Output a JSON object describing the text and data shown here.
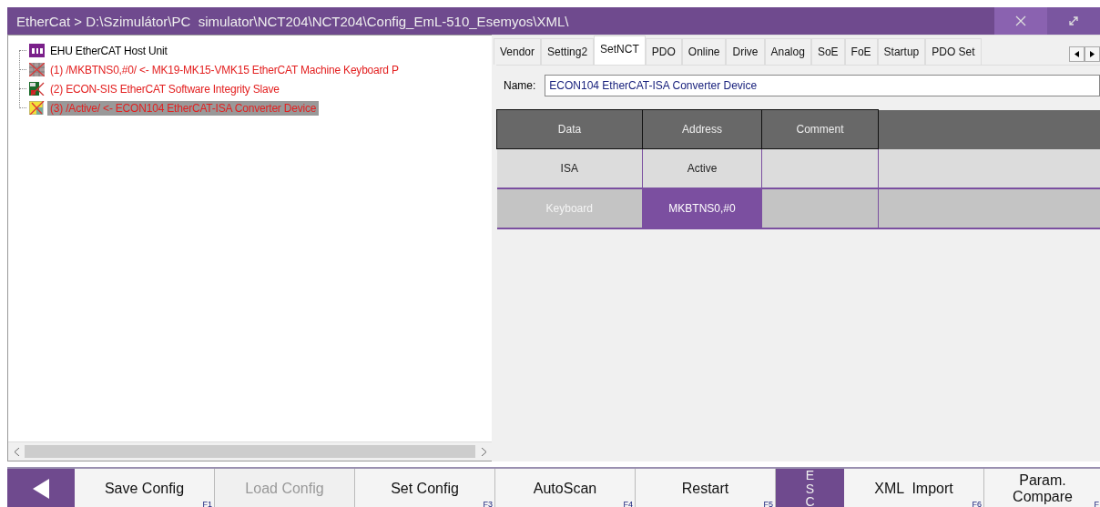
{
  "window": {
    "title": "EtherCat > D:\\Szimulátor\\PC  simulator\\NCT204\\NCT204\\Config_EmL-510_Esemyos\\XML\\"
  },
  "tree": {
    "items": [
      {
        "label": "EHU EtherCAT Host Unit",
        "kind": "host",
        "error": false,
        "selected": false
      },
      {
        "label": "(1) /MKBTNS0,#0/ <- MK19-MK15-VMK15 EtherCAT Machine Keyboard P",
        "kind": "keyboard",
        "error": true,
        "selected": false
      },
      {
        "label": "(2) ECON-SIS EtherCAT Software Integrity Slave",
        "kind": "board",
        "error": true,
        "selected": false
      },
      {
        "label": "(3) /Active/ <- ECON104 EtherCAT-ISA Converter Device",
        "kind": "converter",
        "error": true,
        "selected": true
      }
    ]
  },
  "tabs": [
    {
      "label": "Vendor",
      "selected": false
    },
    {
      "label": "Setting2",
      "selected": false
    },
    {
      "label": "SetNCT",
      "selected": true
    },
    {
      "label": "PDO",
      "selected": false
    },
    {
      "label": "Online",
      "selected": false
    },
    {
      "label": "Drive",
      "selected": false
    },
    {
      "label": "Analog",
      "selected": false
    },
    {
      "label": "SoE",
      "selected": false
    },
    {
      "label": "FoE",
      "selected": false
    },
    {
      "label": "Startup",
      "selected": false
    },
    {
      "label": "PDO Set",
      "selected": false
    }
  ],
  "name_field": {
    "label": "Name:",
    "value": "ECON104 EtherCAT-ISA Converter Device"
  },
  "table": {
    "columns": [
      "Data",
      "Address",
      "Comment"
    ],
    "rows": [
      {
        "data": "ISA",
        "address": "Active",
        "selected": false
      },
      {
        "data": "Keyboard",
        "address": "MKBTNS0,#0",
        "selected": true
      }
    ]
  },
  "toolbar": [
    {
      "kind": "back"
    },
    {
      "kind": "button",
      "label": "Save Config",
      "key": "F1",
      "disabled": false
    },
    {
      "kind": "button",
      "label": "Load Config",
      "disabled": true
    },
    {
      "kind": "button",
      "label": "Set Config",
      "key": "F3",
      "disabled": false
    },
    {
      "kind": "button",
      "label": "AutoScan",
      "key": "F4",
      "disabled": false
    },
    {
      "kind": "button",
      "label": "Restart",
      "key": "F5",
      "disabled": false
    },
    {
      "kind": "esc",
      "label": "ESC"
    },
    {
      "kind": "button",
      "label": "XML  Import",
      "key": "F6",
      "disabled": false
    },
    {
      "kind": "button",
      "label": "Param.\nCompare",
      "key": "F",
      "disabled": false
    }
  ]
}
